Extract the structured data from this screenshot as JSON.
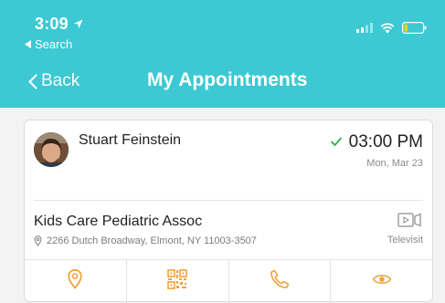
{
  "status_bar": {
    "time": "3:09",
    "back_app": "Search"
  },
  "nav": {
    "back_label": "Back",
    "title": "My Appointments"
  },
  "appointment": {
    "doctor_name": "Stuart Feinstein",
    "time": "03:00 PM",
    "date": "Mon, Mar 23",
    "clinic": "Kids Care Pediatric Assoc",
    "address": "2266 Dutch Broadway, Elmont, NY 11003-3507",
    "visit_type": "Televisit"
  },
  "actions": [
    {
      "icon": "location-pin-icon"
    },
    {
      "icon": "qr-code-icon"
    },
    {
      "icon": "phone-icon"
    },
    {
      "icon": "eye-icon"
    }
  ],
  "colors": {
    "header": "#3cc9d3",
    "accent": "#f0a13c",
    "check": "#2fb34a"
  }
}
